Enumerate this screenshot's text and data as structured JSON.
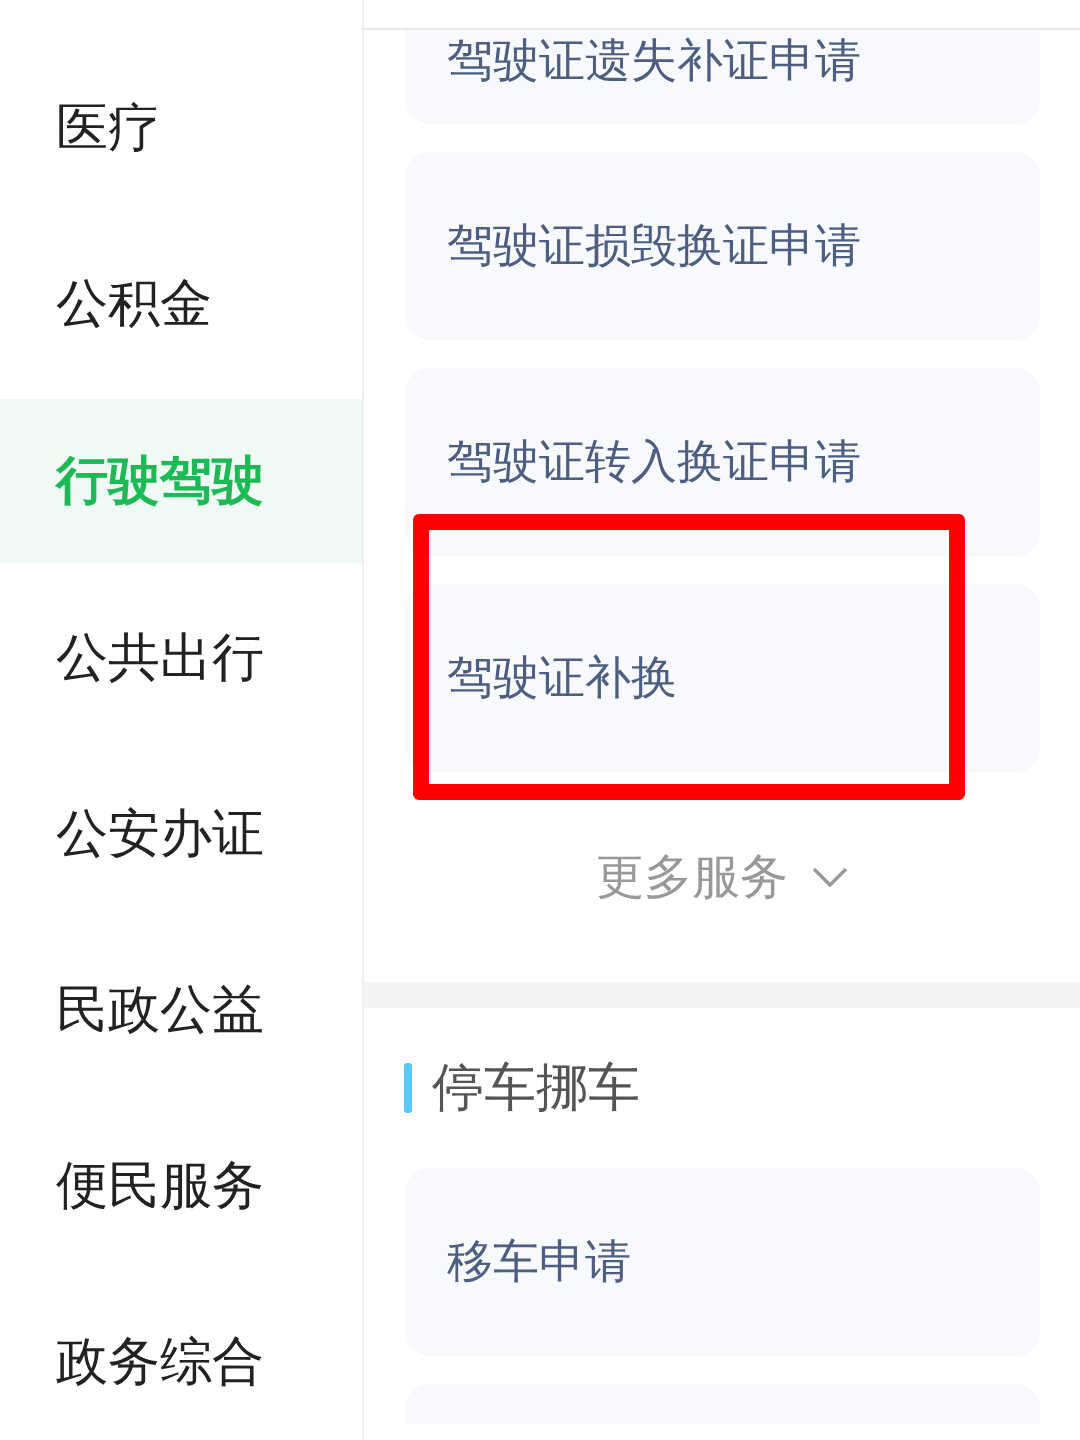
{
  "sidebar": {
    "items": [
      {
        "label": "医疗",
        "selected": false
      },
      {
        "label": "公积金",
        "selected": false
      },
      {
        "label": "行驶驾驶",
        "selected": true
      },
      {
        "label": "公共出行",
        "selected": false
      },
      {
        "label": "公安办证",
        "selected": false
      },
      {
        "label": "民政公益",
        "selected": false
      },
      {
        "label": "便民服务",
        "selected": false
      },
      {
        "label": "政务综合",
        "selected": false
      }
    ]
  },
  "services": {
    "items": [
      {
        "label": "驾驶证遗失补证申请",
        "highlighted": false
      },
      {
        "label": "驾驶证损毁换证申请",
        "highlighted": false
      },
      {
        "label": "驾驶证转入换证申请",
        "highlighted": false
      },
      {
        "label": "驾驶证补换",
        "highlighted": true
      }
    ],
    "more": "更多服务"
  },
  "section": {
    "title": "停车挪车",
    "items": [
      {
        "label": "移车申请",
        "highlighted": false
      }
    ]
  }
}
